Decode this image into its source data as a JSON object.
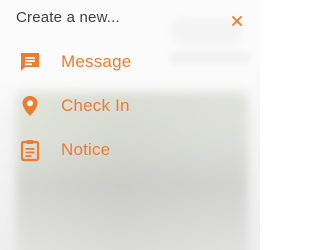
{
  "popup": {
    "title": "Create a new...",
    "items": [
      {
        "label": "Message",
        "icon": "message-icon"
      },
      {
        "label": "Check In",
        "icon": "location-pin-icon"
      },
      {
        "label": "Notice",
        "icon": "clipboard-icon"
      }
    ]
  },
  "colors": {
    "accent": "#ef7b2f",
    "title_text": "#3f3f3f"
  }
}
